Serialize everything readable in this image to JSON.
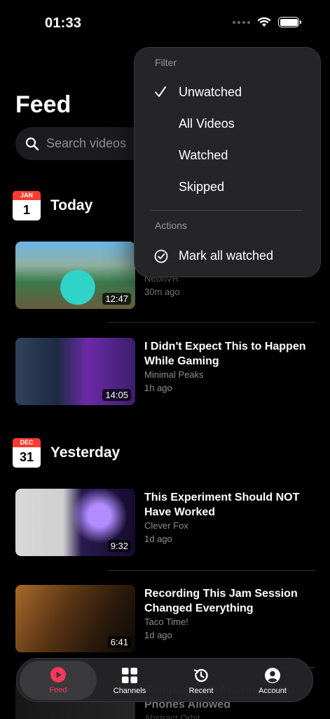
{
  "status": {
    "time": "01:33"
  },
  "page": {
    "title": "Feed"
  },
  "search": {
    "placeholder": "Search videos"
  },
  "sections": {
    "today": {
      "month": "JAN",
      "day": "1",
      "label": "Today"
    },
    "yesterday": {
      "month": "DEC",
      "day": "31",
      "label": "Yesterday"
    }
  },
  "videos": [
    {
      "title": "",
      "channel": "NeonVR",
      "time": "30m ago",
      "duration": "12:47"
    },
    {
      "title": "I Didn't Expect This to Happen While Gaming",
      "channel": "Minimal Peaks",
      "time": "1h ago",
      "duration": "14:05"
    },
    {
      "title": "This Experiment Should NOT Have Worked",
      "channel": "Clever Fox",
      "time": "1d ago",
      "duration": "9:32"
    },
    {
      "title": "Recording This Jam Session Changed Everything",
      "channel": "Taco Time!",
      "time": "1d ago",
      "duration": "6:41"
    },
    {
      "title": "Camping with Friends — No Phones Allowed",
      "channel": "Abstract Orbit",
      "time": "",
      "duration": ""
    }
  ],
  "menu": {
    "filter_header": "Filter",
    "filter_items": [
      "Unwatched",
      "All Videos",
      "Watched",
      "Skipped"
    ],
    "selected_filter": "Unwatched",
    "actions_header": "Actions",
    "mark_all": "Mark all watched"
  },
  "tabs": [
    {
      "label": "Feed",
      "icon": "play-circle-icon",
      "active": true
    },
    {
      "label": "Channels",
      "icon": "grid-icon",
      "active": false
    },
    {
      "label": "Recent",
      "icon": "history-icon",
      "active": false
    },
    {
      "label": "Account",
      "icon": "person-circle-icon",
      "active": false
    }
  ],
  "colors": {
    "accent": "#ff375f",
    "calendar_red": "#ff3b30",
    "background": "#000000"
  }
}
